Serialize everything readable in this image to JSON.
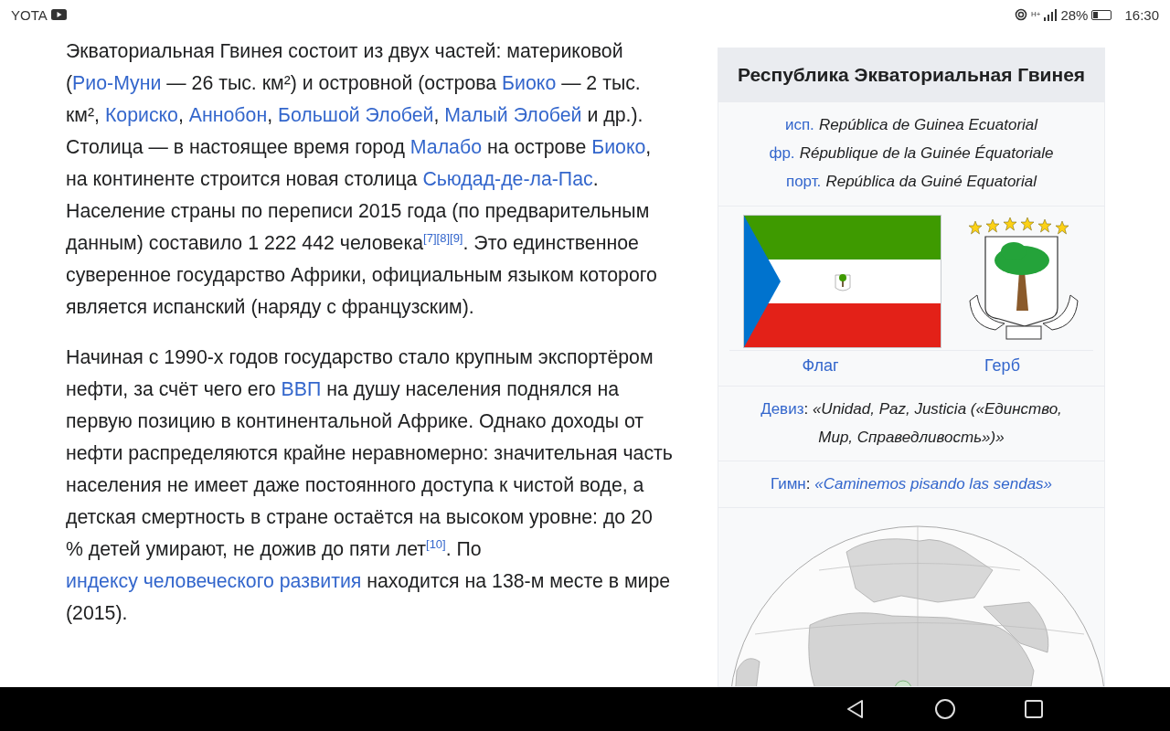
{
  "status_bar": {
    "carrier": "YOTA",
    "network": "H+",
    "battery": "28%",
    "time": "16:30"
  },
  "article": {
    "paragraphs": [
      [
        {
          "kind": "text",
          "text": "Экваториальная Гвинея состоит из двух частей: материковой ("
        },
        {
          "kind": "link",
          "text": "Рио-Муни"
        },
        {
          "kind": "text",
          "text": " — 26 тыс. км²) и островной (острова "
        },
        {
          "kind": "link",
          "text": "Биоко"
        },
        {
          "kind": "text",
          "text": " — 2 тыс. км², "
        },
        {
          "kind": "link",
          "text": "Кориско"
        },
        {
          "kind": "text",
          "text": ", "
        },
        {
          "kind": "link",
          "text": "Аннобон"
        },
        {
          "kind": "text",
          "text": ", "
        },
        {
          "kind": "link",
          "text": "Большой Элобей"
        },
        {
          "kind": "text",
          "text": ", "
        },
        {
          "kind": "link",
          "text": "Малый Элобей"
        },
        {
          "kind": "text",
          "text": " и др.). Столица — в настоящее время город "
        },
        {
          "kind": "link",
          "text": "Малабо"
        },
        {
          "kind": "text",
          "text": " на острове "
        },
        {
          "kind": "link",
          "text": "Биоко"
        },
        {
          "kind": "text",
          "text": ", на континенте строится новая столица "
        },
        {
          "kind": "link",
          "text": "Сьюдад-де-ла-Пас"
        },
        {
          "kind": "text",
          "text": ". Население страны по переписи 2015 года (по предварительным данным) составило 1 222 442 человека"
        },
        {
          "kind": "ref",
          "text": "[7]"
        },
        {
          "kind": "ref",
          "text": "[8]"
        },
        {
          "kind": "ref",
          "text": "[9]"
        },
        {
          "kind": "text",
          "text": ". Это единственное суверенное государство Африки, официальным языком которого является испанский (наряду с французским)."
        }
      ],
      [
        {
          "kind": "text",
          "text": "Начиная с 1990-х годов государство стало крупным экспортёром нефти, за счёт чего его "
        },
        {
          "kind": "link",
          "text": "ВВП"
        },
        {
          "kind": "text",
          "text": " на душу населения поднялся на первую позицию в континентальной Африке. Однако доходы от нефти распределяются крайне неравномерно: значительная часть населения не имеет даже постоянного доступа к чистой воде, а детская смертность в стране остаётся на высоком уровне: до 20 % детей умирают, не дожив до пяти лет"
        },
        {
          "kind": "ref",
          "text": "[10]"
        },
        {
          "kind": "text",
          "text": ". По "
        },
        {
          "kind": "link",
          "text": "индексу человеческого развития"
        },
        {
          "kind": "text",
          "text": " находится на 138-м месте в мире (2015)."
        }
      ]
    ]
  },
  "infobox": {
    "title": "Республика Экваториальная Гвинея",
    "names": [
      [
        {
          "kind": "link",
          "text": "исп."
        },
        {
          "kind": "italic",
          "text": "República de Guinea Ecuatorial"
        }
      ],
      [
        {
          "kind": "link",
          "text": "фр."
        },
        {
          "kind": "italic",
          "text": "République de la Guinée Équatoriale"
        }
      ],
      [
        {
          "kind": "link",
          "text": "порт."
        },
        {
          "kind": "italic",
          "text": "República da Guiné Equatorial"
        }
      ]
    ],
    "images": [
      {
        "kind": "flag",
        "caption": "Флаг"
      },
      {
        "kind": "emblem",
        "caption": "Герб"
      }
    ],
    "motto": [
      {
        "kind": "link",
        "text": "Девиз"
      },
      {
        "kind": "text",
        "text": ": "
      },
      {
        "kind": "italic",
        "text": "«Unidad, Paz, Justicia («Единство, Мир, Справедливость»)»"
      }
    ],
    "anthem": [
      {
        "kind": "link",
        "text": "Гимн"
      },
      {
        "kind": "text",
        "text": ": "
      },
      {
        "kind": "italic-link",
        "text": "«Caminemos pisando las sendas»"
      }
    ],
    "map": {
      "kind": "picture"
    }
  }
}
